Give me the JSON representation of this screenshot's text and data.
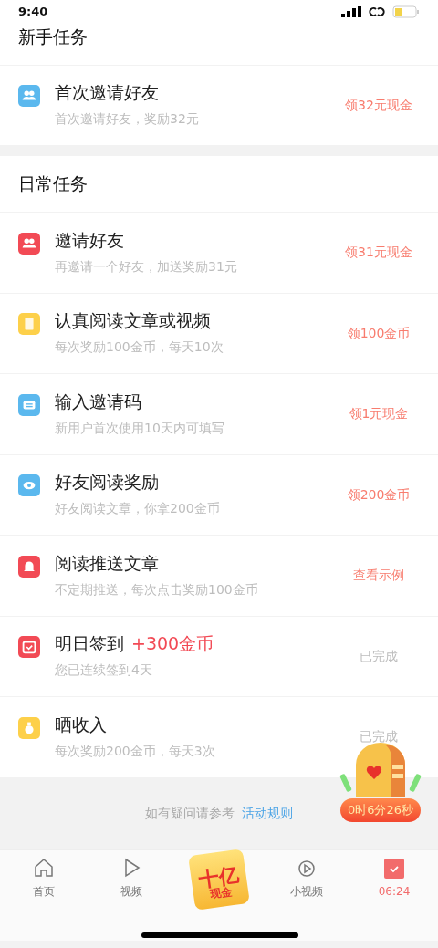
{
  "status_bar": {
    "time": "9:40"
  },
  "newbie_section": {
    "title": "新手任务",
    "tasks": [
      {
        "title": "首次邀请好友",
        "subtitle": "首次邀请好友，奖励32元",
        "action": "领32元现金",
        "done": false,
        "color": "#5bb8ee"
      }
    ]
  },
  "daily_section": {
    "title": "日常任务",
    "tasks": [
      {
        "title": "邀请好友",
        "subtitle": "再邀请一个好友，加送奖励31元",
        "action": "领31元现金",
        "done": false,
        "color": "#f24a55"
      },
      {
        "title": "认真阅读文章或视频",
        "subtitle": "每次奖励100金币，每天10次",
        "action": "领100金币",
        "done": false,
        "color": "#fdd04a"
      },
      {
        "title": "输入邀请码",
        "subtitle": "新用户首次使用10天内可填写",
        "action": "领1元现金",
        "done": false,
        "color": "#5bb8ee"
      },
      {
        "title": "好友阅读奖励",
        "subtitle": "好友阅读文章，你拿200金币",
        "action": "领200金币",
        "done": false,
        "color": "#5bb8ee"
      },
      {
        "title": "阅读推送文章",
        "subtitle": "不定期推送，每次点击奖励100金币",
        "action": "查看示例",
        "done": false,
        "color": "#f24a55"
      },
      {
        "title": "明日签到",
        "bonus": "+300金币",
        "subtitle": "您已连续签到4天",
        "action": "已完成",
        "done": true,
        "color": "#f24a55"
      },
      {
        "title": "晒收入",
        "subtitle": "每次奖励200金币，每天3次",
        "action": "已完成",
        "done": true,
        "color": "#fdd04a"
      }
    ]
  },
  "footer": {
    "text": "如有疑问请参考",
    "link": "活动规则"
  },
  "treasure": {
    "timer": "0时6分26秒"
  },
  "tab_bar": [
    {
      "kind": "home",
      "label": "首页",
      "highlighted": false
    },
    {
      "kind": "video",
      "label": "视频",
      "highlighted": false
    },
    {
      "kind": "promo",
      "line1": "十亿",
      "line2": "现金"
    },
    {
      "kind": "short",
      "label": "小视频",
      "highlighted": false
    },
    {
      "kind": "calendar",
      "label": "06:24",
      "highlighted": true
    }
  ]
}
